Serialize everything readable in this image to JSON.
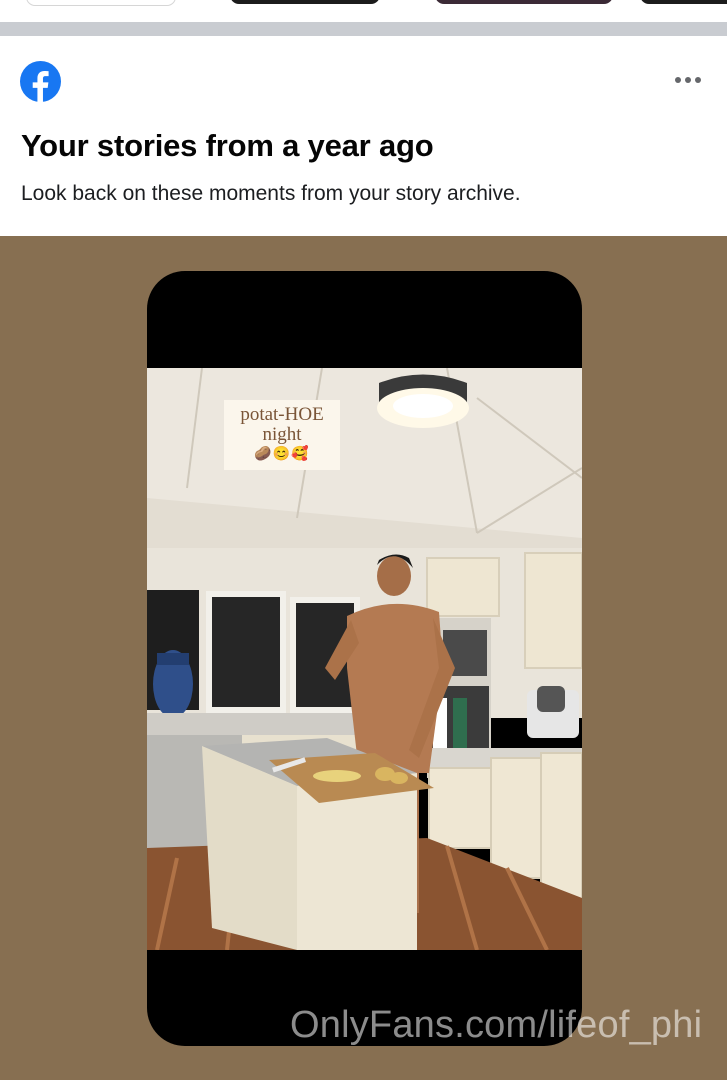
{
  "header": {
    "title": "Your stories from a year ago",
    "subtitle": "Look back on these moments from your story archive.",
    "more_icon": "more-horizontal-icon",
    "logo_icon": "facebook-logo-icon",
    "brand_color": "#1877f2"
  },
  "story": {
    "caption_line1": "potat-HOE",
    "caption_line2": "night",
    "caption_emojis": "🥔😊🥰",
    "watermark": "OnlyFans.com/lifeof_phi",
    "background_color": "#876f51"
  }
}
